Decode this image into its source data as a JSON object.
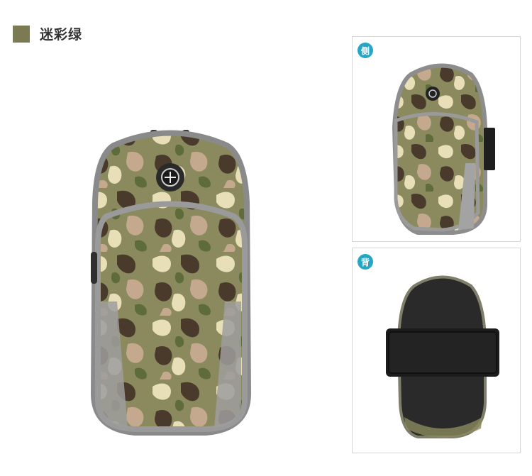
{
  "header": {
    "color_name": "迷彩绿",
    "swatch_color": "#7b7a52"
  },
  "views": [
    {
      "badge": "侧",
      "badge_color": "#25a6c4"
    },
    {
      "badge": "背",
      "badge_color": "#25a6c4"
    }
  ]
}
